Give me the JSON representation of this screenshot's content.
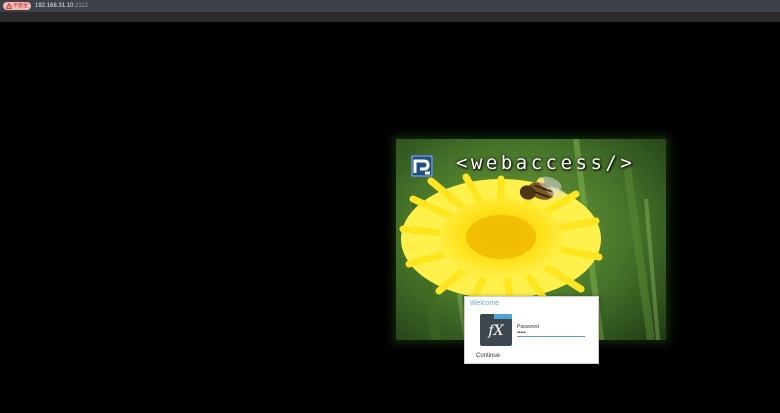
{
  "browser": {
    "security_badge": "不安全",
    "warning_icon": "warning-triangle-icon",
    "url_host": "192.168.31.10",
    "url_port": ":2112"
  },
  "branding": {
    "logo_text": "<webaccess/>",
    "logo_icon": "webaccess-logo-icon"
  },
  "dialog": {
    "title": "Welcome",
    "app_icon": "fx-app-icon",
    "app_glyph": "fX",
    "password_label": "Password",
    "password_value": "•••••",
    "continue_label": "Continue"
  },
  "colors": {
    "topbar": "#3c4248",
    "badge_bg": "#f3b8b4",
    "badge_text": "#c5221f",
    "accent": "#4ba3d8",
    "dialog_title": "#6aa9d8",
    "app_icon_bg": "#3d4750"
  }
}
